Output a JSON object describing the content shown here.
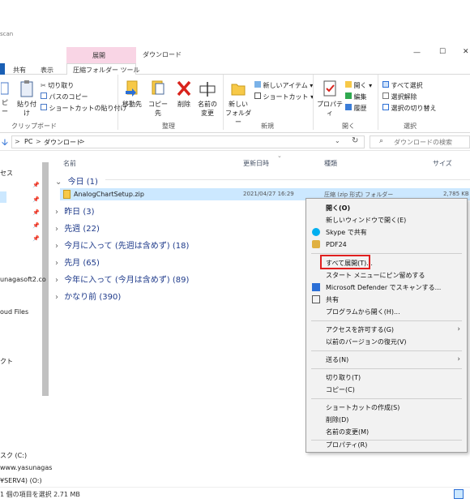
{
  "window": {
    "title_fragment": "scan",
    "context_tab": "展開",
    "folder_title": "ダウンロード",
    "minimize": "—",
    "maximize": "☐",
    "close": "✕"
  },
  "tabs": [
    "共有",
    "表示",
    "圧縮フォルダー ツール"
  ],
  "ribbon": {
    "clipboard": {
      "copy_partial": "ピー",
      "paste": "貼り付け",
      "cut": "切り取り",
      "copy_path": "パスのコピー",
      "paste_shortcut": "ショートカットの貼り付け",
      "group": "クリップボード"
    },
    "organize": {
      "move_to": "移動先",
      "copy_to": "コピー先",
      "delete": "削除",
      "rename_1": "名前の",
      "rename_2": "変更",
      "group": "整理"
    },
    "new": {
      "new_folder_1": "新しい",
      "new_folder_2": "フォルダー",
      "new_item": "新しいアイテム",
      "shortcut": "ショートカット",
      "group": "新規"
    },
    "open": {
      "properties": "プロパティ",
      "open": "開く",
      "edit": "編集",
      "history": "履歴",
      "group": "開く"
    },
    "select": {
      "select_all": "すべて選択",
      "select_none": "選択解除",
      "invert": "選択の切り替え",
      "group": "選択"
    }
  },
  "address": {
    "pc": "PC",
    "folder": "ダウンロード",
    "search_placeholder": "ダウンロードの検索",
    "sep": ">"
  },
  "columns": {
    "name": "名前",
    "date": "更新日時",
    "type": "種類",
    "size": "サイズ"
  },
  "nav": [
    "セス",
    "unagasoft2.co",
    "oud Files",
    "クト",
    "スク (C:)",
    "www.yasunagas",
    "¥SERV4) (O:)"
  ],
  "groups": [
    {
      "label": "今日 (1)",
      "expanded": true
    },
    {
      "label": "昨日 (3)"
    },
    {
      "label": "先週 (22)"
    },
    {
      "label": "今月に入って (先週は含めず) (18)"
    },
    {
      "label": "先月 (65)"
    },
    {
      "label": "今年に入って (今月は含めず) (89)"
    },
    {
      "label": "かなり前 (390)"
    }
  ],
  "file": {
    "name": "AnalogChartSetup.zip",
    "date": "2021/04/27 16:29",
    "type": "圧縮 (zip 形式) フォルダー",
    "size": "2,785 KB"
  },
  "context_menu": {
    "items": [
      {
        "label": "開く(O)",
        "bold": true
      },
      {
        "label": "新しいウィンドウで開く(E)"
      },
      {
        "label": "Skype で共有",
        "icon": "skype-icon"
      },
      {
        "label": "PDF24",
        "icon": "pdf24-icon"
      },
      {
        "label": "すべて展開(T)...",
        "highlighted": true
      },
      {
        "label": "スタート メニューにピン留めする"
      },
      {
        "label": "Microsoft Defender でスキャンする...",
        "icon": "defender-icon"
      },
      {
        "label": "共有",
        "icon": "share-icon"
      },
      {
        "label": "プログラムから開く(H)..."
      },
      {
        "label": "アクセスを許可する(G)",
        "submenu": true
      },
      {
        "label": "以前のバージョンの復元(V)"
      },
      {
        "label": "送る(N)",
        "submenu": true
      },
      {
        "label": "切り取り(T)"
      },
      {
        "label": "コピー(C)"
      },
      {
        "label": "ショートカットの作成(S)"
      },
      {
        "label": "削除(D)"
      },
      {
        "label": "名前の変更(M)"
      },
      {
        "label": "プロパティ(R)"
      }
    ]
  },
  "status": {
    "text": "1 個の項目を選択  2.71 MB"
  },
  "colors": {
    "accent": "#0078d7",
    "context_tab": "#f9d5e5",
    "highlight_box": "#e02020",
    "selected_row": "#cce8ff"
  }
}
